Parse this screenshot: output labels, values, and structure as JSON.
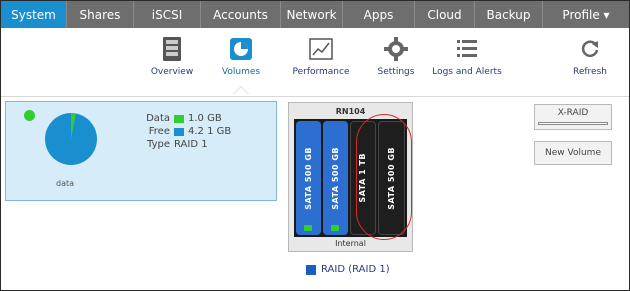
{
  "nav": {
    "tabs": [
      {
        "label": "System",
        "active": true
      },
      {
        "label": "Shares",
        "active": false
      },
      {
        "label": "iSCSI",
        "active": false
      },
      {
        "label": "Accounts",
        "active": false
      },
      {
        "label": "Network",
        "active": false
      },
      {
        "label": "Apps",
        "active": false
      },
      {
        "label": "Cloud",
        "active": false
      },
      {
        "label": "Backup",
        "active": false
      },
      {
        "label": "Profile ▾",
        "active": false
      }
    ],
    "active_color": "#1a8fd0"
  },
  "toolbar": {
    "items": [
      {
        "label": "Overview",
        "icon": "overview-icon"
      },
      {
        "label": "Volumes",
        "icon": "volumes-icon",
        "active": true
      },
      {
        "label": "Performance",
        "icon": "performance-icon"
      },
      {
        "label": "Settings",
        "icon": "settings-icon"
      },
      {
        "label": "Logs and Alerts",
        "icon": "logs-icon"
      },
      {
        "label": "Refresh",
        "icon": "refresh-icon"
      }
    ]
  },
  "volume": {
    "name": "data",
    "status_color": "#2fcf2f",
    "data_label": "Data",
    "data_value": "1.0 GB",
    "data_color": "#2fcf2f",
    "free_label": "Free",
    "free_value": "4.2 1 GB",
    "free_color": "#1a8fd0",
    "type_label": "Type",
    "type_value": "RAID 1",
    "used_fraction": 0.03
  },
  "enclosure": {
    "title": "RN104",
    "label": "Internal",
    "disks": [
      {
        "text": "SATA 500 GB",
        "color": "blue"
      },
      {
        "text": "SATA 500 GB",
        "color": "blue"
      },
      {
        "text": "SATA 1 TB",
        "color": "black"
      },
      {
        "text": "SATA 500 GB",
        "color": "black"
      }
    ]
  },
  "raid": {
    "label": "RAID (RAID 1)",
    "color": "#1a5fc0"
  },
  "buttons": {
    "xraid": "X-RAID",
    "new_volume": "New Volume"
  }
}
